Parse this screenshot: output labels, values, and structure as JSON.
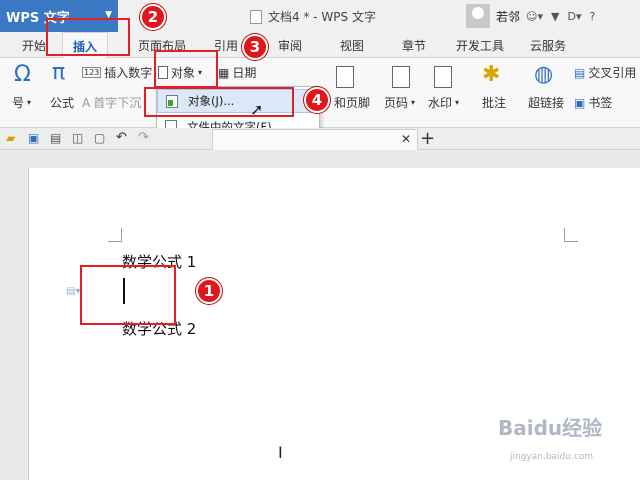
{
  "title_bar": {
    "app_button": "WPS 文字",
    "doc_title": "文档4 * - WPS 文字",
    "user_name": "若邻"
  },
  "tabs": [
    "开始",
    "插入",
    "页面布局",
    "引用",
    "审阅",
    "视图",
    "章节",
    "开发工具",
    "云服务"
  ],
  "ribbon": {
    "symbol": "号",
    "formula": "公式",
    "insert_number": "插入数字",
    "drop_cap": "首字下沉",
    "object": "对象",
    "date": "日期",
    "header_footer": "和页脚",
    "page_number": "页码",
    "watermark": "水印",
    "comment": "批注",
    "hyperlink": "超链接",
    "cross_ref": "交叉引用",
    "bookmark": "书签"
  },
  "dropdown": {
    "item_object": "对象(J)...",
    "item_text_from_file": "文件中的文字(F)..."
  },
  "document": {
    "line1": "数学公式 1",
    "line2": "数学公式 2"
  },
  "steps": [
    "1",
    "2",
    "3",
    "4"
  ],
  "watermark": {
    "brand": "Baidu经验",
    "url": "jingyan.baidu.com"
  },
  "colors": {
    "accent": "#3b78c3",
    "callout_red": "#e31e24"
  }
}
